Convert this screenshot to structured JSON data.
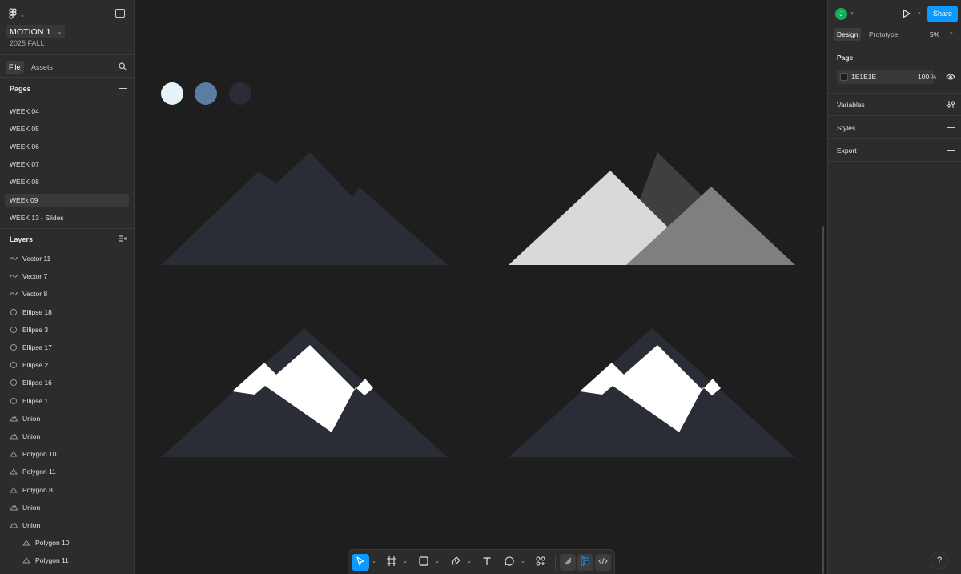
{
  "left": {
    "file_title": "MOTION 1",
    "file_subtitle": "2025 FALL",
    "tabs": [
      "File",
      "Assets"
    ],
    "pages_header": "Pages",
    "pages": [
      "WEEK 04",
      "WEEK 05",
      "WEEK 06",
      "WEEK 07",
      "WEEK 08",
      "WEEk 09",
      "WEEK 13 - Slides"
    ],
    "selected_page": "WEEk 09",
    "layers_header": "Layers",
    "layers": [
      {
        "name": "Vector 11",
        "icon": "vector-icon"
      },
      {
        "name": "Vector 7",
        "icon": "vector-icon"
      },
      {
        "name": "Vector 8",
        "icon": "vector-icon"
      },
      {
        "name": "Ellipse 18",
        "icon": "ellipse-icon"
      },
      {
        "name": "Ellipse 3",
        "icon": "ellipse-icon"
      },
      {
        "name": "Ellipse 17",
        "icon": "ellipse-icon"
      },
      {
        "name": "Ellipse 2",
        "icon": "ellipse-icon"
      },
      {
        "name": "Ellipse 16",
        "icon": "ellipse-icon"
      },
      {
        "name": "Ellipse 1",
        "icon": "ellipse-icon"
      },
      {
        "name": "Union",
        "icon": "union-icon"
      },
      {
        "name": "Union",
        "icon": "union-icon"
      },
      {
        "name": "Polygon 10",
        "icon": "polygon-icon"
      },
      {
        "name": "Polygon 11",
        "icon": "polygon-icon"
      },
      {
        "name": "Polygon 8",
        "icon": "polygon-icon"
      },
      {
        "name": "Union",
        "icon": "union-icon"
      },
      {
        "name": "Union",
        "icon": "union-icon"
      },
      {
        "name": "Polygon 10",
        "icon": "polygon-icon"
      },
      {
        "name": "Polygon 11",
        "icon": "polygon-icon"
      }
    ]
  },
  "canvas": {
    "background": "#1E1E1E",
    "swatches": [
      "#E6F2F8",
      "#5B7CA4",
      "#2A2D35"
    ],
    "mountain_dark": "#2A2D35",
    "mountain_light": "#D9D9D9",
    "mountain_mid": "#7F7F7F",
    "mountain_back": "#3F3F3F",
    "snow": "#FFFFFF"
  },
  "toolbar": {
    "tools": [
      "move-tool",
      "frame-tool",
      "shape-tool",
      "pen-tool",
      "text-tool",
      "comment-tool",
      "actions-tool",
      "draw-mode",
      "design-mode",
      "dev-mode"
    ]
  },
  "right": {
    "avatar_initial": "J",
    "share_label": "Share",
    "tabs": [
      "Design",
      "Prototype"
    ],
    "zoom": "5%",
    "page_header": "Page",
    "page_color": "1E1E1E",
    "page_opacity": "100",
    "page_opacity_unit": "%",
    "variables_label": "Variables",
    "styles_label": "Styles",
    "export_label": "Export",
    "help_label": "?"
  },
  "colors": {
    "accent": "#0D99FF",
    "avatar": "#14AE5C",
    "panel": "#2C2C2C"
  }
}
